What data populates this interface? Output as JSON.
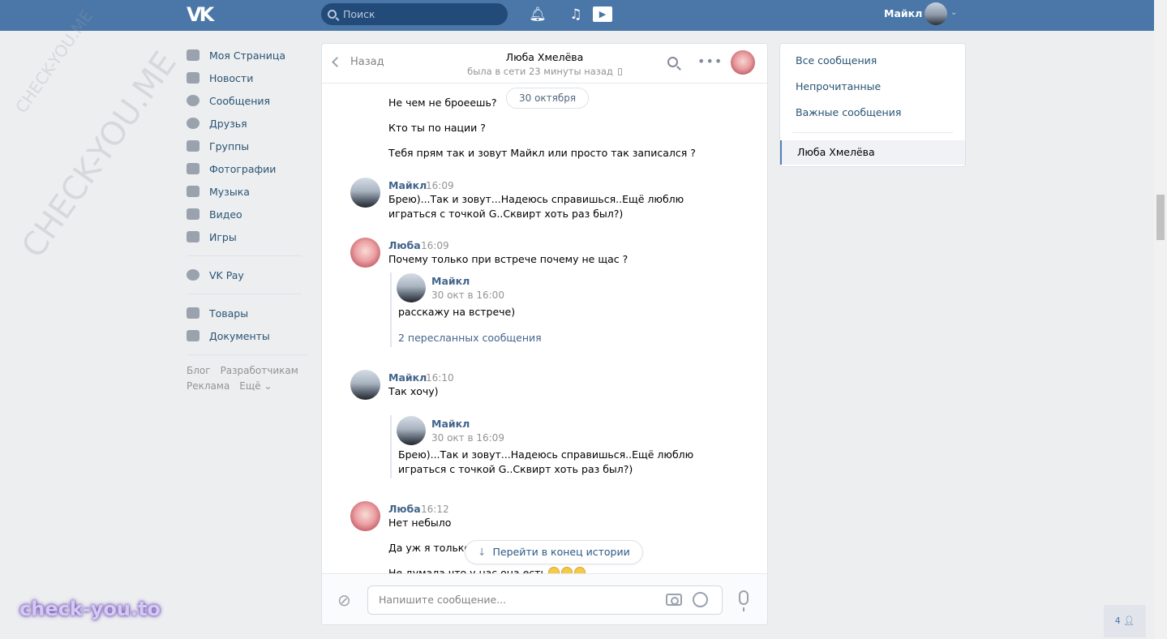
{
  "header": {
    "search_placeholder": "Поиск",
    "user_name": "Майкл"
  },
  "sidebar": {
    "items": [
      {
        "label": "Моя Страница"
      },
      {
        "label": "Новости"
      },
      {
        "label": "Сообщения"
      },
      {
        "label": "Друзья"
      },
      {
        "label": "Группы"
      },
      {
        "label": "Фотографии"
      },
      {
        "label": "Музыка"
      },
      {
        "label": "Видео"
      },
      {
        "label": "Игры"
      },
      {
        "label": "VK Pay"
      },
      {
        "label": "Товары"
      },
      {
        "label": "Документы"
      }
    ],
    "footer": [
      "Блог",
      "Разработчикам",
      "Реклама",
      "Ещё ⌄"
    ]
  },
  "chat": {
    "back_label": "Назад",
    "peer_name": "Люба Хмелёва",
    "peer_status": "была в сети 23 минуты назад",
    "date_pill": "30 октября",
    "messages": {
      "m1": "Не чем не броеешь?",
      "m2": "Кто ты по нации ?",
      "m3": "Тебя прям так и зовут Майкл или просто так записался ?",
      "g1_author": "Майкл",
      "g1_time": "16:09",
      "g1_text1": "Брею)...Так и зовут...Надеюсь справишься..Ещё люблю",
      "g1_text2": "играться с точкой G..Сквирт хоть раз был?)",
      "g2_author": "Люба",
      "g2_time": "16:09",
      "g2_text": "Почему только при встрече почему не щас ?",
      "g2_fwd_author": "Майкл",
      "g2_fwd_date": "30 окт в 16:00",
      "g2_fwd_text": "расскажу на встрече)",
      "g2_fwd_link": "2 пересланных сообщения",
      "g3_author": "Майкл",
      "g3_time": "16:10",
      "g3_text": "Так хочу)",
      "g3_fwd_author": "Майкл",
      "g3_fwd_date": "30 окт в 16:09",
      "g3_fwd_text1": "Брею)...Так и зовут...Надеюсь справишься..Ещё люблю",
      "g3_fwd_text2": "играться с точкой G..Сквирт хоть раз был?)",
      "g4_author": "Люба",
      "g4_time": "16:12",
      "g4_text1": "Нет небыло",
      "g4_text2": "Да уж я только",
      "g4_text3": "Не думала что у нас она есть"
    },
    "jump_label": "Перейти в конец истории",
    "composer_placeholder": "Напишите сообщение..."
  },
  "filters": {
    "all": "Все сообщения",
    "unread": "Непрочитанные",
    "important": "Важные сообщения",
    "active": "Люба Хмелёва"
  },
  "online_count": "4",
  "watermark": "check-you.to",
  "watermark_diag": "CHECK-YOU.ME",
  "icons": [
    "vk-logo-icon",
    "search-icon",
    "bell-icon",
    "music-icon",
    "video-icon",
    "chevron-down-icon",
    "back-chevron-icon",
    "phone-icon",
    "more-icon",
    "attach-icon",
    "camera-icon",
    "smile-icon",
    "mic-icon",
    "arrow-down-icon",
    "user-icon"
  ],
  "colors": {
    "header": "#4a76a8",
    "link": "#285473",
    "author": "#42648b",
    "background": "#edeef0"
  }
}
